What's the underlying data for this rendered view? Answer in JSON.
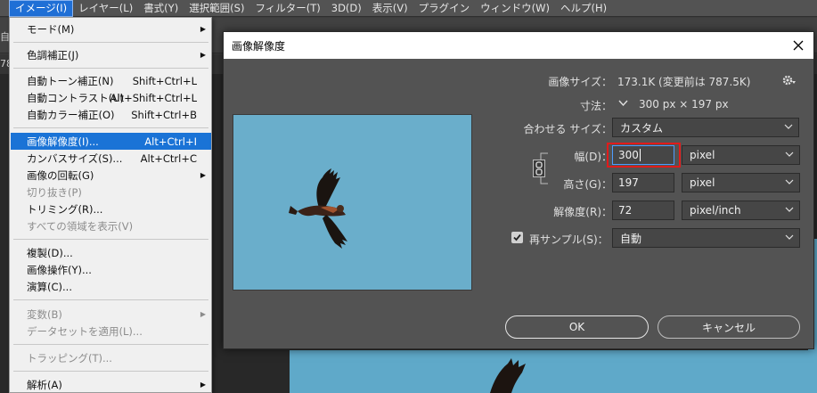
{
  "menubar": {
    "items": [
      "イメージ(I)",
      "レイヤー(L)",
      "書式(Y)",
      "選択範囲(S)",
      "フィルター(T)",
      "3D(D)",
      "表示(V)",
      "プラグイン",
      "ウィンドウ(W)",
      "ヘルプ(H)"
    ]
  },
  "left_fragments": [
    "自",
    "78"
  ],
  "image_menu": {
    "items": [
      {
        "label": "モード(M)",
        "shortcut": "",
        "submenu": true,
        "disabled": false
      },
      {
        "label": "色調補正(J)",
        "shortcut": "",
        "submenu": true,
        "disabled": false
      },
      {
        "label": "自動トーン補正(N)",
        "shortcut": "Shift+Ctrl+L",
        "submenu": false,
        "disabled": false
      },
      {
        "label": "自動コントラスト(U)",
        "shortcut": "Alt+Shift+Ctrl+L",
        "submenu": false,
        "disabled": false
      },
      {
        "label": "自動カラー補正(O)",
        "shortcut": "Shift+Ctrl+B",
        "submenu": false,
        "disabled": false
      },
      {
        "label": "画像解像度(I)...",
        "shortcut": "Alt+Ctrl+I",
        "submenu": false,
        "disabled": false,
        "selected": true
      },
      {
        "label": "カンバスサイズ(S)...",
        "shortcut": "Alt+Ctrl+C",
        "submenu": false,
        "disabled": false
      },
      {
        "label": "画像の回転(G)",
        "shortcut": "",
        "submenu": true,
        "disabled": false
      },
      {
        "label": "切り抜き(P)",
        "shortcut": "",
        "submenu": false,
        "disabled": true
      },
      {
        "label": "トリミング(R)...",
        "shortcut": "",
        "submenu": false,
        "disabled": false
      },
      {
        "label": "すべての領域を表示(V)",
        "shortcut": "",
        "submenu": false,
        "disabled": true
      },
      {
        "label": "複製(D)...",
        "shortcut": "",
        "submenu": false,
        "disabled": false
      },
      {
        "label": "画像操作(Y)...",
        "shortcut": "",
        "submenu": false,
        "disabled": false
      },
      {
        "label": "演算(C)...",
        "shortcut": "",
        "submenu": false,
        "disabled": false
      },
      {
        "label": "変数(B)",
        "shortcut": "",
        "submenu": true,
        "disabled": true
      },
      {
        "label": "データセットを適用(L)...",
        "shortcut": "",
        "submenu": false,
        "disabled": true
      },
      {
        "label": "トラッピング(T)...",
        "shortcut": "",
        "submenu": false,
        "disabled": true
      },
      {
        "label": "解析(A)",
        "shortcut": "",
        "submenu": true,
        "disabled": false
      }
    ]
  },
  "dialog": {
    "title": "画像解像度",
    "image_size_label": "画像サイズ：",
    "image_size_value": "173.1K (変更前は 787.5K)",
    "dimensions_label": "寸法：",
    "dimensions_value": "300 px × 197 px",
    "fit_to_label": "合わせる サイズ：",
    "fit_to_value": "カスタム",
    "width_label": "幅(D)：",
    "width_value": "300",
    "width_unit": "pixel",
    "height_label": "高さ(G)：",
    "height_value": "197",
    "height_unit": "pixel",
    "resolution_label": "解像度(R)：",
    "resolution_value": "72",
    "resolution_unit": "pixel/inch",
    "resample_label": "再サンプル(S)：",
    "resample_value": "自動",
    "resample_checked": true,
    "ok_label": "OK",
    "cancel_label": "キャンセル"
  },
  "colors": {
    "sky": "#6aaecb",
    "menu_highlight": "#1a73d6",
    "focus_red": "#e01b1b"
  }
}
